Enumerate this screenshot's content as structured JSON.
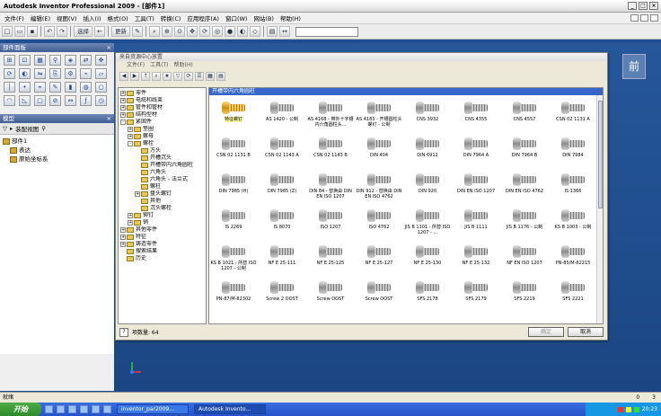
{
  "window": {
    "title": "Autodesk Inventor Professional 2009 - [部件1]"
  },
  "menu": [
    "文件(F)",
    "编辑(E)",
    "视图(V)",
    "插入(I)",
    "格式(O)",
    "工具(T)",
    "转换(C)",
    "应用程序(A)",
    "窗口(W)",
    "网站(B)",
    "帮助(H)"
  ],
  "toolbar": {
    "select_label": "选择",
    "update_label": "更新"
  },
  "panel": {
    "title": "部件面板",
    "icons": [
      "place-component-icon",
      "create-component-icon",
      "pattern-icon",
      "constraint-icon",
      "place-from-center-icon",
      "replace-icon",
      "move-icon",
      "rotate-icon",
      "section-icon",
      "mirror-icon",
      "copy-icon",
      "bolt-icon",
      "weld-icon",
      "work-plane-icon",
      "work-axis-icon",
      "work-point-icon",
      "ucs-icon",
      "sketch-icon",
      "extrude-icon",
      "revolve-icon",
      "hole-icon",
      "fillet-icon",
      "chamfer-icon",
      "shell-icon",
      "split-icon",
      "measure-icon",
      "param-icon",
      "clock-icon"
    ]
  },
  "browser": {
    "title": "模型",
    "view_label": "装配视图",
    "items": [
      "部件1",
      "表达",
      "原始坐标系"
    ]
  },
  "dialog": {
    "title": "来自资源中心放置",
    "menu": [
      "文件(F)",
      "工具(T)",
      "帮助(H)"
    ],
    "breadcrumb": "开槽带内六角圆柱",
    "tree": [
      {
        "label": "零件",
        "depth": 0,
        "exp": "+"
      },
      {
        "label": "电缆和线束",
        "depth": 0,
        "exp": "+"
      },
      {
        "label": "管件和管材",
        "depth": 0,
        "exp": "+"
      },
      {
        "label": "结构型材",
        "depth": 0,
        "exp": "+"
      },
      {
        "label": "紧固件",
        "depth": 0,
        "exp": "-"
      },
      {
        "label": "垫圈",
        "depth": 1,
        "exp": "+"
      },
      {
        "label": "螺母",
        "depth": 1,
        "exp": "+"
      },
      {
        "label": "螺栓",
        "depth": 1,
        "exp": "-"
      },
      {
        "label": "方头",
        "depth": 2,
        "exp": ""
      },
      {
        "label": "开槽沉头",
        "depth": 2,
        "exp": ""
      },
      {
        "label": "开槽带内六角圆柱",
        "depth": 2,
        "exp": ""
      },
      {
        "label": "六角头",
        "depth": 2,
        "exp": ""
      },
      {
        "label": "六角头 - 法兰式",
        "depth": 2,
        "exp": ""
      },
      {
        "label": "螺柱",
        "depth": 2,
        "exp": ""
      },
      {
        "label": "盘头螺钉",
        "depth": 2,
        "exp": "+"
      },
      {
        "label": "其他",
        "depth": 2,
        "exp": ""
      },
      {
        "label": "沉头螺栓",
        "depth": 2,
        "exp": ""
      },
      {
        "label": "铆钉",
        "depth": 1,
        "exp": "+"
      },
      {
        "label": "销",
        "depth": 1,
        "exp": "+"
      },
      {
        "label": "其他零件",
        "depth": 0,
        "exp": "+"
      },
      {
        "label": "特征",
        "depth": 0,
        "exp": "+"
      },
      {
        "label": "铸造零件",
        "depth": 0,
        "exp": "+"
      },
      {
        "label": "搜索结果",
        "depth": 0,
        "exp": ""
      },
      {
        "label": "历史",
        "depth": 0,
        "exp": ""
      }
    ],
    "items": [
      "特征螺钉",
      "AS 1420 - 公制",
      "AS 4168 - 带外十字槽内六角圆柱头...",
      "AS 4183 - 开槽圆柱头螺钉 - 公制",
      "CNS 3932",
      "CNS 4355",
      "CNS 4557",
      "CSN 02 1131 A",
      "CSN 02 1131 B",
      "CSN 02 1143 A",
      "CSN 02 1143 B",
      "DIN 404",
      "DIN 6912",
      "DIN 7964 A",
      "DIN 7964 B",
      "DIN 7984",
      "DIN 7985 (H)",
      "DIN 7985 (Z)",
      "DIN 84 - 替换由 DIN EN ISO 1207",
      "DIN 912 - 替换由 DIN EN ISO 4762",
      "DIN 920",
      "DIN EN ISO 1207",
      "DIN EN ISO 4762",
      "IS 1366",
      "IS 2269",
      "IS 8070",
      "ISO 1207",
      "ISO 4762",
      "JIS B 1101 - 所替 ISO 1207 - ...",
      "JIS B 1111",
      "JIS B 1176 - 公制",
      "KS B 1003 - 公制",
      "KS B 1021 - 所替 ISO 1207 - 公制",
      "NF E 25-111",
      "NF E 25-125",
      "NF E 25-127",
      "NF E 25-130",
      "NF E 25-132",
      "NF EN ISO 1207",
      "PN-85/M-82215",
      "PN-87/M-82302",
      "Screw 2 OOST",
      "Screw OOST",
      "Screw OOST",
      "SFS 2178",
      "SFS 2179",
      "SFS 2219",
      "SFS 2221"
    ],
    "count_label": "项数量: 64",
    "ok_label": "确定",
    "cancel_label": "取消"
  },
  "status": {
    "text": "就绪",
    "num1": "0",
    "num2": "3"
  },
  "taskbar": {
    "start_label": "开始",
    "tasks": [
      "inventor_par2009...",
      "Autodesk Invento..."
    ],
    "clock": "20:23"
  }
}
